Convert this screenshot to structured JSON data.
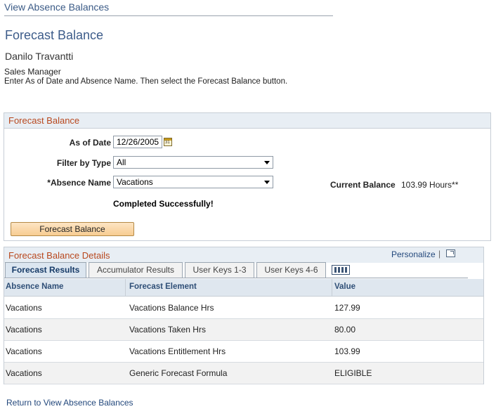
{
  "header": {
    "top_link": "View Absence Balances",
    "page_title": "Forecast Balance",
    "employee_name": "Danilo Travantti",
    "job_title": "Sales Manager",
    "instructions": "Enter As of Date and Absence Name. Then select the Forecast Balance button."
  },
  "forecast": {
    "group_title": "Forecast Balance",
    "as_of_date_label": "As of Date",
    "as_of_date_value": "12/26/2005",
    "filter_label": "Filter by Type",
    "filter_value": "All",
    "absence_label": "*Absence Name",
    "absence_value": "Vacations",
    "current_balance_label": "Current Balance",
    "current_balance_value": "103.99 Hours**",
    "status": "Completed Successfully!",
    "button_label": "Forecast Balance",
    "calendar_icon": "calendar-icon",
    "calendar_icon_text": "31"
  },
  "details": {
    "group_title": "Forecast Balance Details",
    "personalize": "Personalize",
    "separator": "|",
    "tabs": [
      {
        "label": "Forecast Results"
      },
      {
        "label": "Accumulator Results"
      },
      {
        "label": "User Keys 1-3"
      },
      {
        "label": "User Keys 4-6"
      }
    ],
    "columns": [
      "Absence Name",
      "Forecast Element",
      "Value"
    ],
    "rows": [
      {
        "name": "Vacations",
        "element": "Vacations Balance Hrs",
        "value": "127.99"
      },
      {
        "name": "Vacations",
        "element": "Vacations Taken Hrs",
        "value": "80.00"
      },
      {
        "name": "Vacations",
        "element": "Vacations Entitlement Hrs",
        "value": "103.99"
      },
      {
        "name": "Vacations",
        "element": "Generic Forecast Formula",
        "value": "ELIGIBLE"
      }
    ]
  },
  "footer": {
    "return_link": "Return to View Absence Balances"
  }
}
